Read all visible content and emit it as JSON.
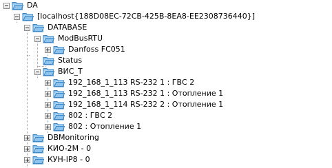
{
  "colors": {
    "folder_fill": "#8fc3ec",
    "folder_dark": "#3b88c8",
    "folder_light": "#d3ebfb",
    "tree_line": "#a0a0a0",
    "toggle_border": "#8e8f8f"
  },
  "tree": [
    {
      "label": "DA",
      "level": 0,
      "state": "expanded",
      "icon": "folder-icon"
    },
    {
      "label": "[localhost{188D08EC-72CB-425B-8EA8-EE2308736440}]",
      "level": 1,
      "state": "expanded",
      "icon": "folder-icon"
    },
    {
      "label": "DATABASE",
      "level": 2,
      "state": "expanded",
      "icon": "folder-icon"
    },
    {
      "label": "ModBusRTU",
      "level": 3,
      "state": "expanded",
      "icon": "folder-icon"
    },
    {
      "label": "Danfoss FC051",
      "level": 4,
      "state": "collapsed",
      "icon": "folder-icon"
    },
    {
      "label": "Status",
      "level": 3,
      "state": "leaf",
      "icon": "folder-icon"
    },
    {
      "label": "ВИС_Т",
      "level": 3,
      "state": "expanded",
      "icon": "folder-icon"
    },
    {
      "label": "192_168_1_113 RS-232 1 : ГВС 2",
      "level": 4,
      "state": "collapsed",
      "icon": "folder-icon"
    },
    {
      "label": "192_168_1_113 RS-232 1 : Отопление 1",
      "level": 4,
      "state": "collapsed",
      "icon": "folder-icon"
    },
    {
      "label": "192_168_1_114 RS-232 2 : Отопление 1",
      "level": 4,
      "state": "collapsed",
      "icon": "folder-icon"
    },
    {
      "label": "802 : ГВС 2",
      "level": 4,
      "state": "collapsed",
      "icon": "folder-icon"
    },
    {
      "label": "802 : Отопление 1",
      "level": 4,
      "state": "collapsed",
      "icon": "folder-icon"
    },
    {
      "label": "DBMonitoring",
      "level": 2,
      "state": "collapsed",
      "icon": "folder-icon"
    },
    {
      "label": "КИО-2М - 0",
      "level": 2,
      "state": "collapsed",
      "icon": "folder-icon"
    },
    {
      "label": "КУН-IP8 - 0",
      "level": 2,
      "state": "collapsed",
      "icon": "folder-icon"
    }
  ]
}
